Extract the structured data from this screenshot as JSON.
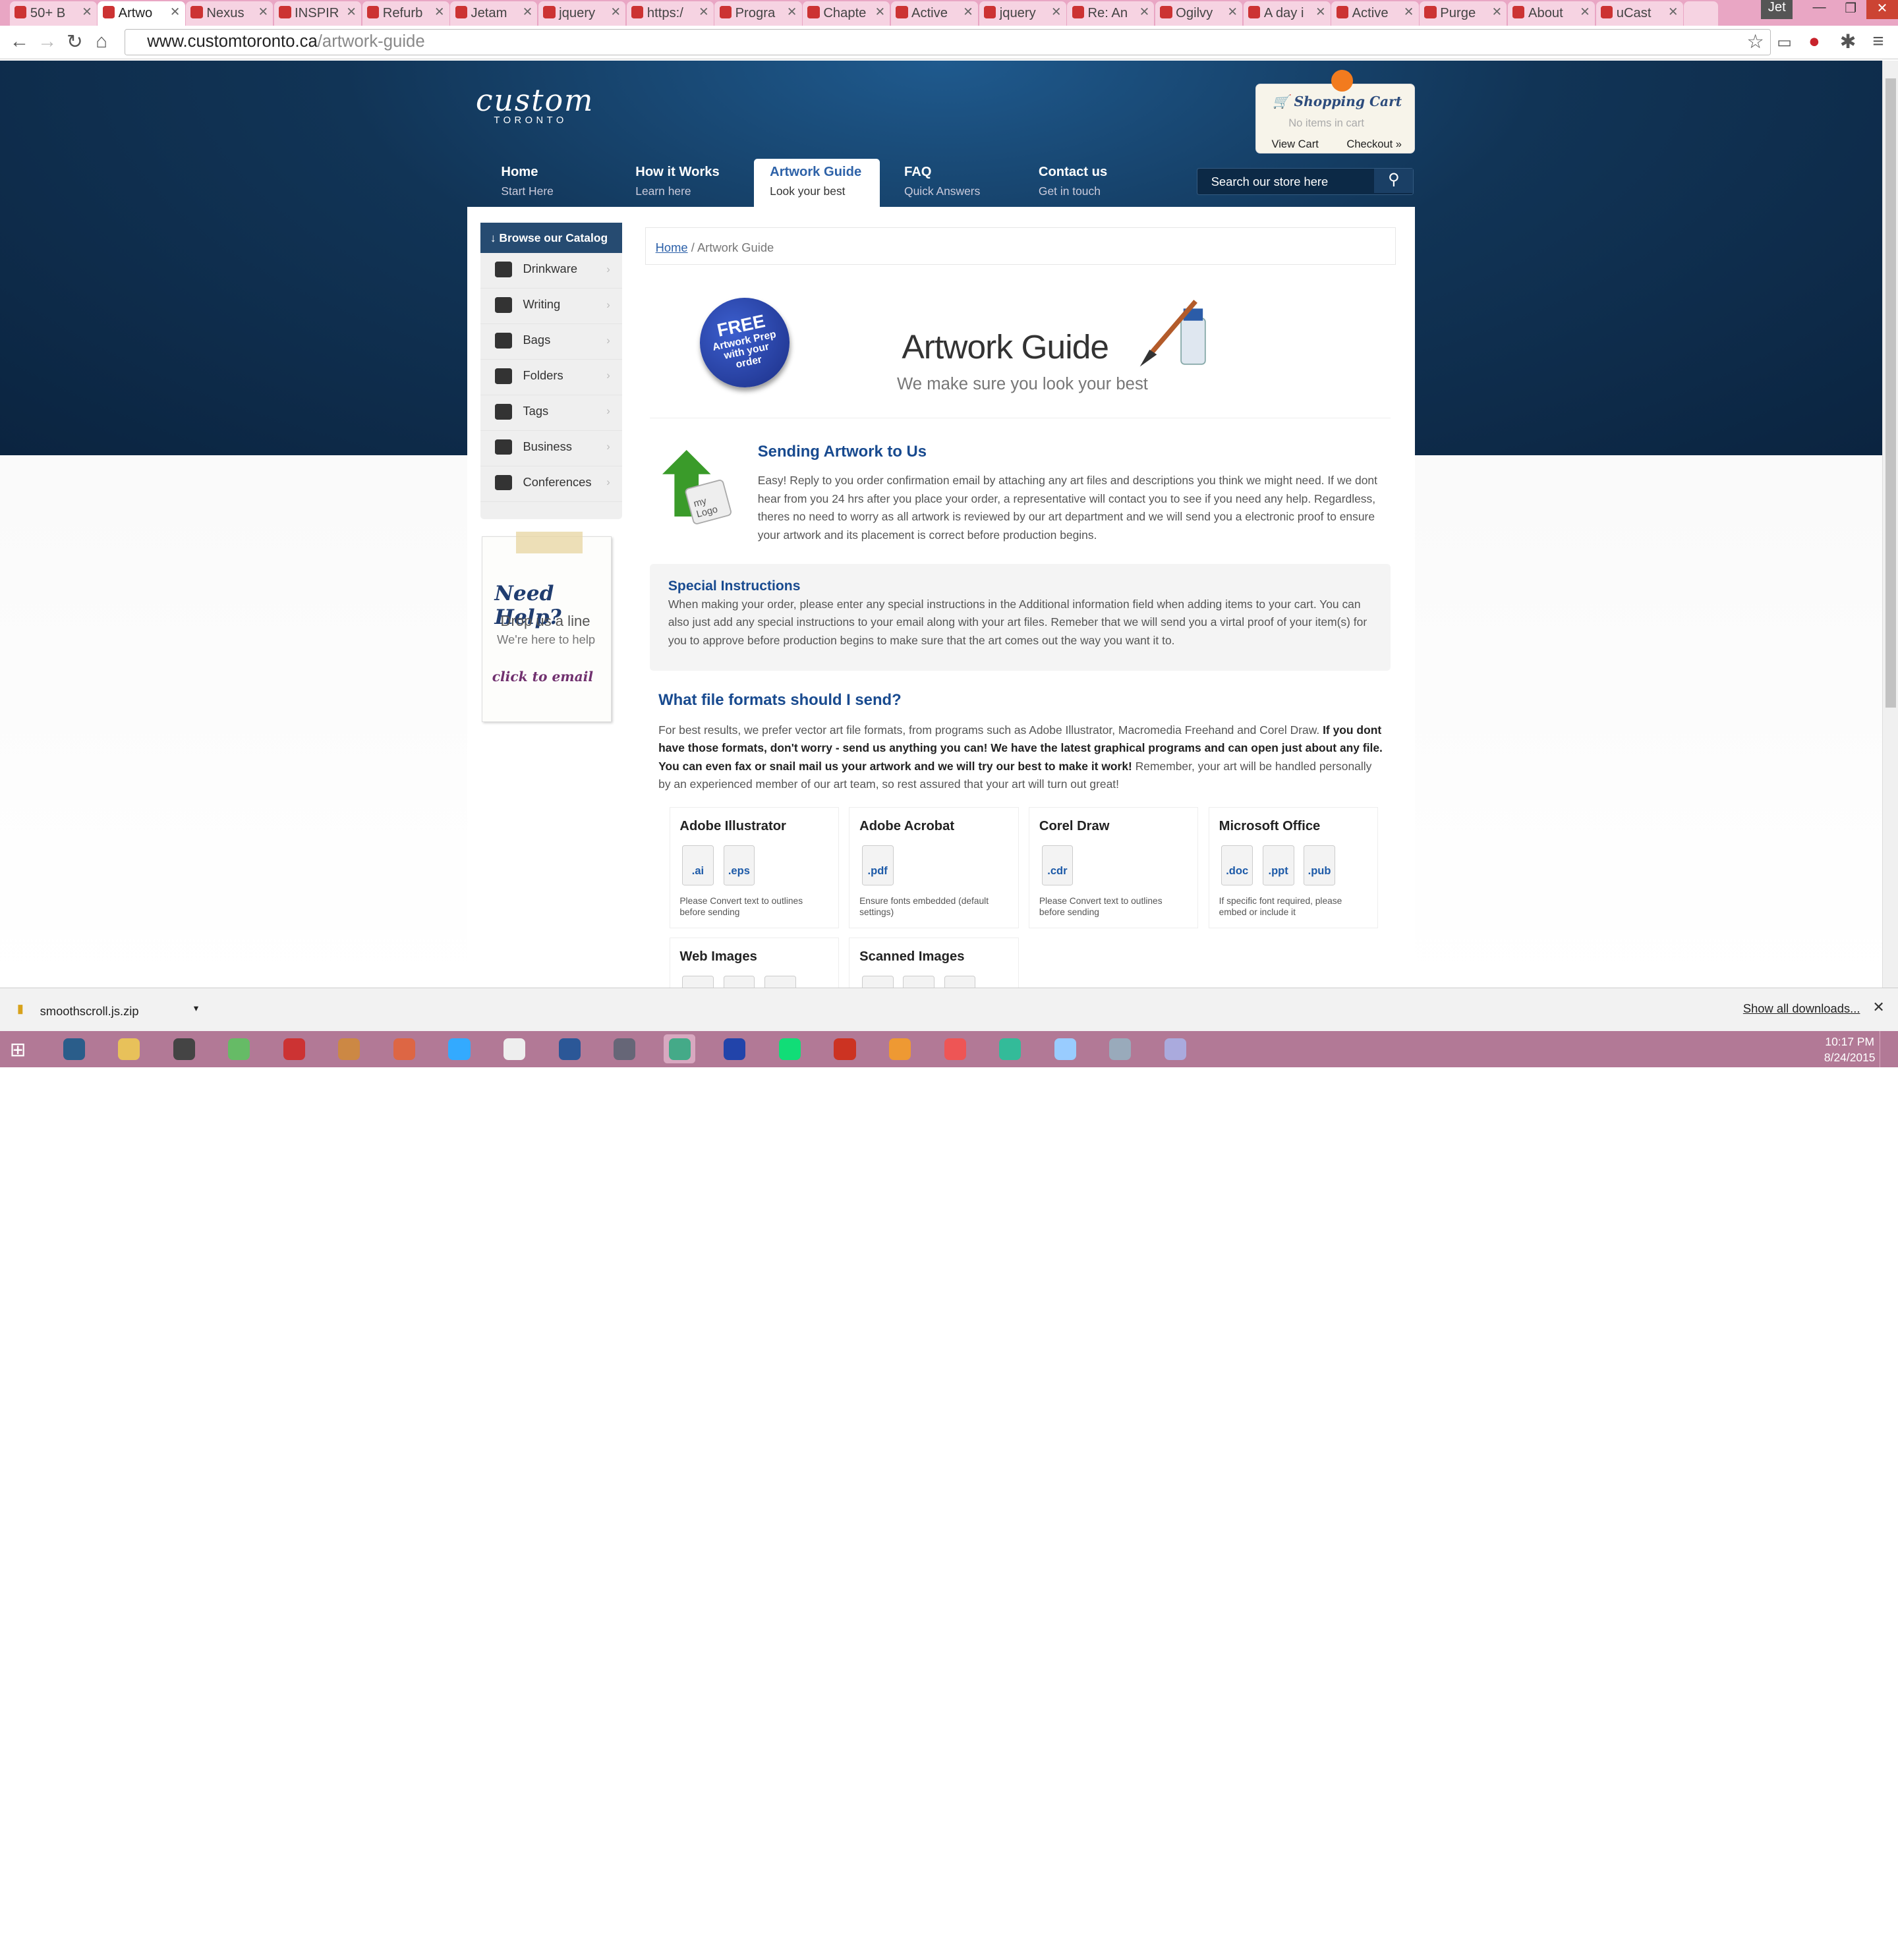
{
  "browser": {
    "tabs": [
      "50+ B",
      "Artwo",
      "Nexus",
      "INSPIR",
      "Refurb",
      "Jetam",
      "jquery",
      "https:/",
      "Progra",
      "Chapte",
      "Active",
      "jquery",
      "Re: An",
      "Ogilvy",
      "A day i",
      "Active",
      "Purge",
      "About",
      "uCast"
    ],
    "url_host": "www.customtoronto.ca",
    "url_path": "/artwork-guide",
    "user": "Jet"
  },
  "site": {
    "logo": "custom",
    "logo_sub": "TORONTO",
    "cart": {
      "title": "Shopping Cart",
      "status": "No items in cart",
      "view": "View Cart",
      "checkout": "Checkout »"
    },
    "nav": [
      {
        "title": "Home",
        "sub": "Start Here"
      },
      {
        "title": "How it Works",
        "sub": "Learn here"
      },
      {
        "title": "Artwork Guide",
        "sub": "Look your best"
      },
      {
        "title": "FAQ",
        "sub": "Quick Answers"
      },
      {
        "title": "Contact us",
        "sub": "Get in touch"
      }
    ],
    "search_placeholder": "Search our store here",
    "catalog": {
      "header": "Browse our Catalog",
      "items": [
        "Drinkware",
        "Writing",
        "Bags",
        "Folders",
        "Tags",
        "Business",
        "Conferences"
      ]
    },
    "help": {
      "title": "Need Help?",
      "line1": "Drop us a line",
      "line2": "We're here to help",
      "cta": "click to email"
    },
    "breadcrumb": {
      "home": "Home",
      "sep": "/",
      "current": "Artwork Guide"
    },
    "badge": {
      "l1": "FREE",
      "l2": "Artwork Prep",
      "l3": "with your",
      "l4": "order"
    },
    "guide": {
      "title": "Artwork Guide",
      "subtitle": "We make sure you look your best"
    },
    "logo_art": {
      "l1": "my",
      "l2": "Logo"
    },
    "sending": {
      "title": "Sending Artwork to Us",
      "body": "Easy! Reply to you order confirmation email by attaching any art files and descriptions you think we might need. If we dont hear from you 24 hrs after you place your order, a representative will contact you to see if you need any help. Regardless, theres no need to worry as all artwork is reviewed by our art department and we will send you a electronic proof to ensure your artwork and its placement is correct before production begins."
    },
    "special": {
      "title": "Special Instructions",
      "body": "When making your order, please enter any special instructions in the Additional information field when adding items to your cart. You can also just add any special instructions to your email along with your art files. Remeber that we will send you a virtal proof of your item(s) for you to approve before production begins to make sure that the art comes out the way you want it to."
    },
    "formats": {
      "title": "What file formats should I send?",
      "body1": "For best results, we prefer vector art file formats, from programs such as Adobe Illustrator, Macromedia Freehand and Corel Draw. ",
      "body_bold": "If you dont have those formats, don't worry - send us anything you can! We have the latest graphical programs and can open just about any file. You can even fax or snail mail us your artwork and we will try our best to make it work!",
      "body2": " Remember, your art will be handled personally by an experienced member of our art team, so rest assured that your art will turn out great!",
      "cards": [
        {
          "name": "Adobe Illustrator",
          "exts": [
            ".ai",
            ".eps"
          ],
          "note": "Please Convert text to outlines before sending"
        },
        {
          "name": "Adobe Acrobat",
          "exts": [
            ".pdf"
          ],
          "note": "Ensure fonts embedded (default settings)"
        },
        {
          "name": "Corel Draw",
          "exts": [
            ".cdr"
          ],
          "note": "Please Convert text to outlines before sending"
        },
        {
          "name": "Microsoft Office",
          "exts": [
            ".doc",
            ".ppt",
            ".pub"
          ],
          "note": "If specific font required, please embed or include it"
        },
        {
          "name": "Web Images",
          "exts": [],
          "note": ""
        },
        {
          "name": "Scanned Images",
          "exts": [],
          "note": ""
        }
      ]
    }
  },
  "downloads": {
    "file": "smoothscroll.js.zip",
    "show_all": "Show all downloads..."
  },
  "clock": {
    "time": "10:17 PM",
    "date": "8/24/2015"
  }
}
